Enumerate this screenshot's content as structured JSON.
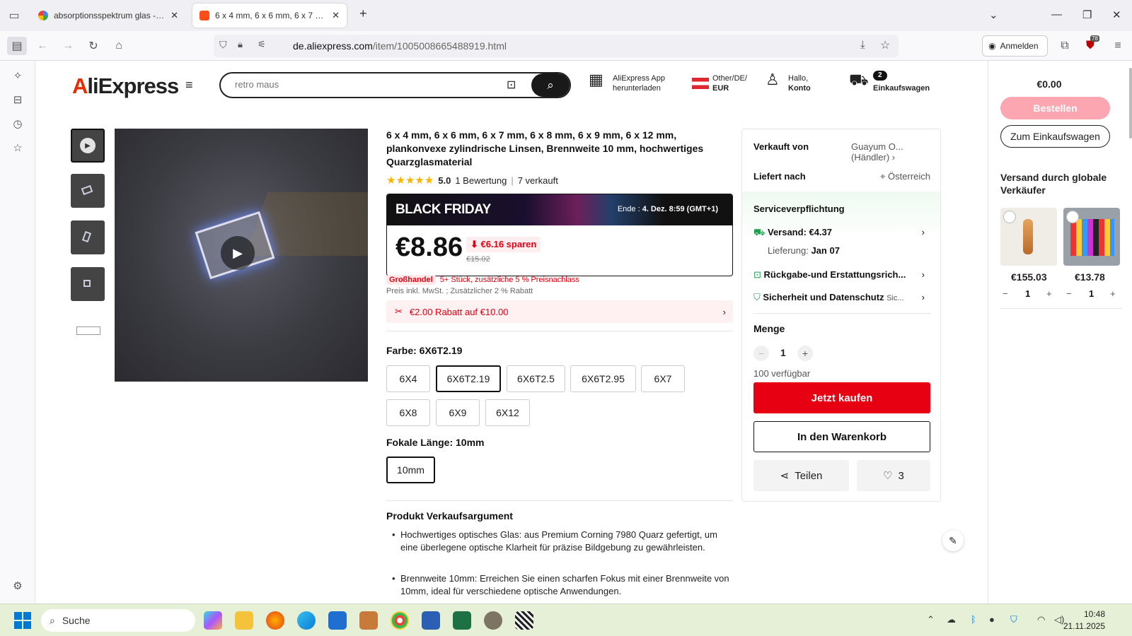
{
  "browser": {
    "tabs": [
      {
        "title": "absorptionsspektrum glas - Go",
        "icon": "google-icon"
      },
      {
        "title": "6 x 4 mm, 6 x 6 mm, 6 x 7 mm, 6",
        "icon": "aliexpress-icon"
      }
    ],
    "new_tab": "+",
    "url_domain": "de.aliexpress.com",
    "url_path": "/item/1005008665488919.html",
    "signin_label": "Anmelden",
    "extension_badge": "78"
  },
  "header": {
    "logo": "AliExpress",
    "search_placeholder": "retro maus",
    "app_line1": "AliExpress App",
    "app_line2": "herunterladen",
    "region_line1": "Other/DE/",
    "region_line2": "EUR",
    "account_line1": "Hallo,",
    "account_line2": "Konto",
    "cart_count": "2",
    "cart_label": "Einkaufswagen"
  },
  "product": {
    "title": "6 x 4 mm, 6 x 6 mm, 6 x 7 mm, 6 x 8 mm, 6 x 9 mm, 6 x 12 mm, plankonvexe zylindrische Linsen, Brennweite 10 mm, hochwertiges Quarzglasmaterial",
    "rating": "5.0",
    "reviews": "1 Bewertung",
    "sold": "7 verkauft",
    "black_friday": "BLACK FRIDAY",
    "end_label": "Ende :",
    "end_date": "4. Dez. 8:59 (GMT+1)",
    "price": "€8.86",
    "save": "€6.16 sparen",
    "old_price": "€15.02",
    "wholesale_badge": "Großhandel",
    "wholesale_text": "5+ Stück, zusätzliche 5 % Preisnachlass",
    "vat_text": "Preis inkl. MwSt. ; Zusätzlicher 2 % Rabatt",
    "coupon": "€2.00 Rabatt auf €10.00",
    "color_label": "Farbe: 6X6T2.19",
    "colors": [
      "6X4",
      "6X6T2.19",
      "6X6T2.5",
      "6X6T2.95",
      "6X7",
      "6X8",
      "6X9",
      "6X12"
    ],
    "focal_label": "Fokale Länge: 10mm",
    "focal_options": [
      "10mm"
    ],
    "selling_title": "Produkt Verkaufsargument",
    "bullets": [
      "Hochwertiges optisches Glas: aus Premium Corning 7980 Quarz gefertigt, um eine überlegene optische Klarheit für präzise Bildgebung zu gewährleisten.",
      "Brennweite 10mm: Erreichen Sie einen scharfen Fokus mit einer Brennweite von 10mm, ideal für verschiedene optische Anwendungen."
    ]
  },
  "panel": {
    "sold_by_label": "Verkauft von",
    "seller": "Guayum O...",
    "seller_type": "(Händler)",
    "ships_to_label": "Liefert nach",
    "ships_to": "Österreich",
    "service_title": "Serviceverpflichtung",
    "shipping": "Versand: €4.37",
    "delivery_label": "Lieferung:",
    "delivery_date": "Jan 07",
    "returns": "Rückgabe-und Erstattungsrich...",
    "security": "Sicherheit und Datenschutz",
    "security_more": "Sic...",
    "qty_title": "Menge",
    "qty": "1",
    "available": "100 verfügbar",
    "buy_now": "Jetzt kaufen",
    "add_cart": "In den Warenkorb",
    "share": "Teilen",
    "likes": "3"
  },
  "cart": {
    "total": "€0.00",
    "buy": "Bestellen",
    "to_cart": "Zum Einkaufswagen",
    "title": "Versand durch globale Verkäufer",
    "items": [
      {
        "price": "€155.03",
        "qty": "1"
      },
      {
        "price": "€13.78",
        "qty": "1"
      }
    ]
  },
  "taskbar": {
    "search": "Suche",
    "time": "10:48",
    "date": "21.11.2025"
  },
  "colors": {
    "accent": "#e60012",
    "buy_disabled": "#fba6b0",
    "taskbar": "#e6f0d6"
  }
}
